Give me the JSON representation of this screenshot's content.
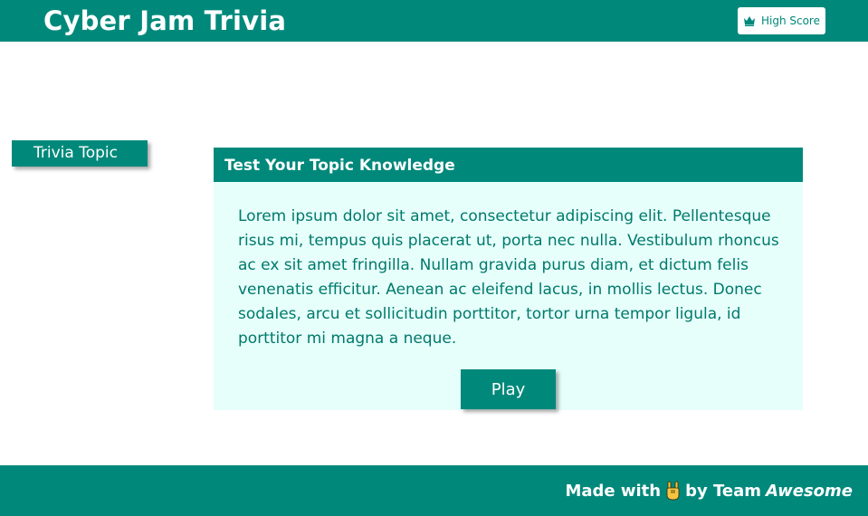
{
  "header": {
    "title": "Cyber Jam Trivia",
    "high_score_label": "High Score",
    "high_score_icon": "crown-icon"
  },
  "sidebar": {
    "topic_label": "Trivia Topic"
  },
  "card": {
    "title": "Test Your Topic Knowledge",
    "body": "Lorem ipsum dolor sit amet, consectetur adipiscing elit. Pellentesque risus mi, tempus quis placerat ut, porta nec nulla. Vestibulum rhoncus ac ex sit amet fringilla. Nullam gravida purus diam, et dictum felis venenatis efficitur. Aenean ac eleifend lacus, in mollis lectus. Donec sodales, arcu et sollicitudin porttitor, tortor urna tempor ligula, id porttitor mi magna a neque.",
    "play_label": "Play"
  },
  "footer": {
    "made_with": "Made with",
    "icon": "rock-on-hand-icon",
    "by_team": "by Team",
    "team_name": "Awesome"
  },
  "colors": {
    "primary": "#00897b",
    "card_background": "#e6fffb",
    "body_text": "#00796b"
  }
}
